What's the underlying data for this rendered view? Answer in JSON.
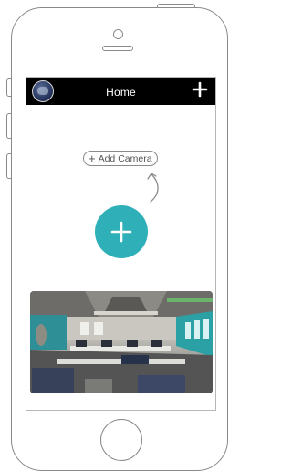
{
  "header": {
    "title": "Home"
  },
  "main": {
    "add_camera_label": "Add Camera"
  },
  "colors": {
    "accent": "#2fb0b8",
    "topbar": "#000000"
  },
  "icons": {
    "avatar": "globe-avatar-icon",
    "top_add": "plus-icon",
    "pill_add": "plus-icon",
    "hint_arrow": "curved-arrow-icon",
    "fab": "plus-icon"
  }
}
